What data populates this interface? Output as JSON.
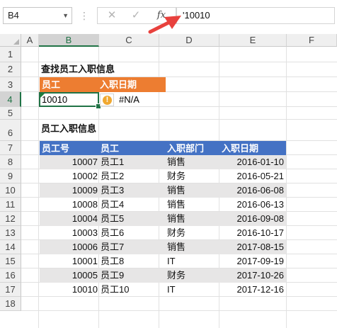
{
  "formula_bar": {
    "name_box": "B4",
    "cancel_icon": "✕",
    "enter_icon": "✓",
    "fx_label": "fx",
    "formula": "'10010"
  },
  "columns": [
    "A",
    "B",
    "C",
    "D",
    "E",
    "F"
  ],
  "rows": [
    "1",
    "2",
    "3",
    "4",
    "5",
    "6",
    "7",
    "8",
    "9",
    "10",
    "11",
    "12",
    "13",
    "14",
    "15",
    "16",
    "17",
    "18"
  ],
  "lookup": {
    "section_title": "查找员工入职信息",
    "header_employee": "员工",
    "header_hire_date": "入职日期",
    "input_value": "10010",
    "result": "#N/A"
  },
  "table": {
    "section_title": "员工入职信息",
    "headers": [
      "员工号",
      "员工",
      "入职部门",
      "入职日期"
    ],
    "rows": [
      [
        "10007",
        "员工1",
        "销售",
        "2016-01-10"
      ],
      [
        "10002",
        "员工2",
        "财务",
        "2016-05-21"
      ],
      [
        "10009",
        "员工3",
        "销售",
        "2016-06-08"
      ],
      [
        "10008",
        "员工4",
        "销售",
        "2016-06-13"
      ],
      [
        "10004",
        "员工5",
        "销售",
        "2016-09-08"
      ],
      [
        "10003",
        "员工6",
        "财务",
        "2016-10-17"
      ],
      [
        "10006",
        "员工7",
        "销售",
        "2017-08-15"
      ],
      [
        "10001",
        "员工8",
        "IT",
        "2017-09-19"
      ],
      [
        "10005",
        "员工9",
        "财务",
        "2017-10-26"
      ],
      [
        "10010",
        "员工10",
        "IT",
        "2017-12-16"
      ]
    ]
  },
  "colors": {
    "orange_header": "#ed7d31",
    "blue_header": "#4472c4",
    "band": "#e7e6e6",
    "selection": "#217346"
  }
}
